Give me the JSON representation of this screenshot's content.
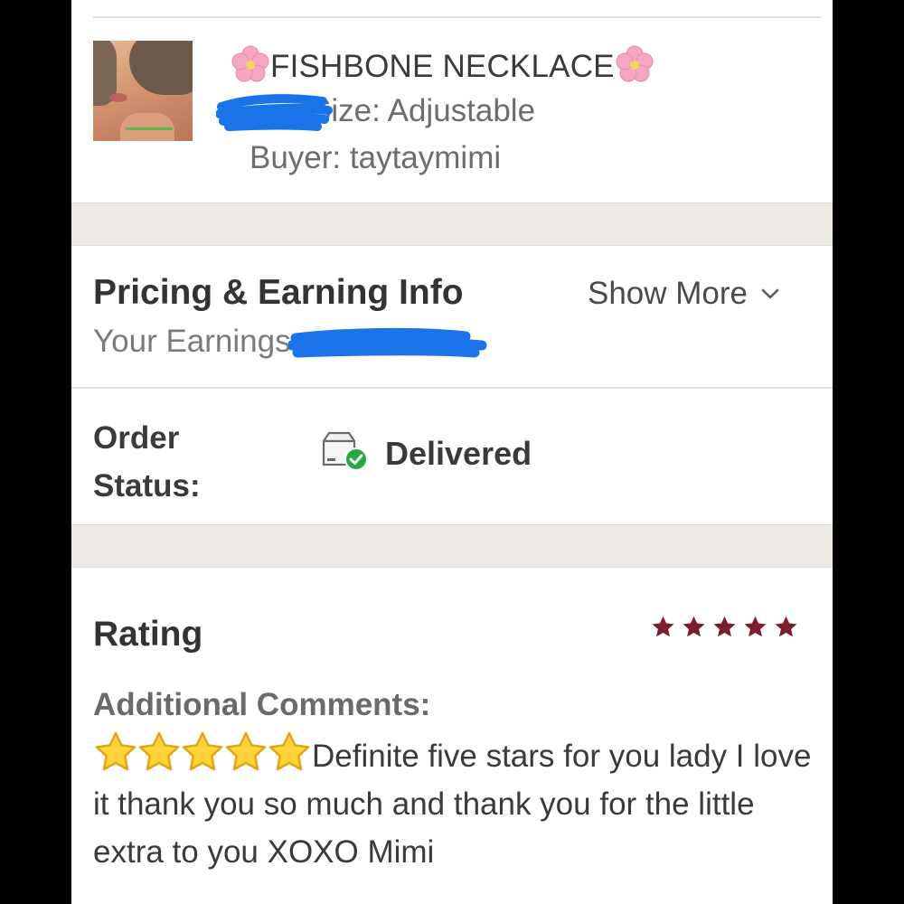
{
  "order_item": {
    "title": "FISHBONE NECKLACE",
    "title_emoji_left": "cherry-blossom",
    "title_emoji_right": "cherry-blossom",
    "size": "Size: Adjustable",
    "buyer": "Buyer: taytaymimi"
  },
  "pricing": {
    "title": "Pricing & Earning Info",
    "show_more": "Show More",
    "earnings_label": "Your Earnings"
  },
  "order_status": {
    "label": "Order Status:",
    "value": "Delivered",
    "icon": "delivered-box-check-icon"
  },
  "rating": {
    "title": "Rating",
    "stars": 5,
    "star_color": "#7c1d2b",
    "comments_title": "Additional Comments:",
    "comment_emoji": "star-emoji x5",
    "comment_text": "Definite five stars for you lady I love it thank you so much and thank you for the little extra to you XOXO Mimi"
  },
  "colors": {
    "redaction": "#1a73e8",
    "separator_band": "#edeae6",
    "check_green": "#27a844"
  }
}
